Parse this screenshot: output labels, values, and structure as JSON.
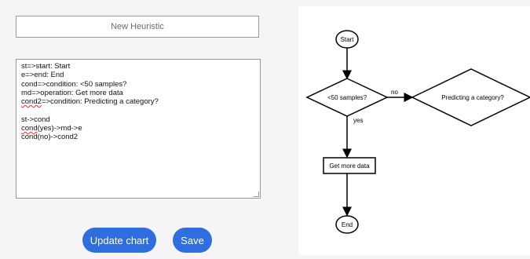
{
  "editor": {
    "name_placeholder": "New Heuristic",
    "code_lines": [
      {
        "text": "st=>start: Start",
        "err": ""
      },
      {
        "text": "e=>end: End",
        "err": ""
      },
      {
        "text": "cond=>condition: <50 samples?",
        "err": ""
      },
      {
        "text": "md=>operation: Get more data",
        "err": ""
      },
      {
        "pre": "",
        "err": "cond2",
        "text": "=>condition: Predicting a category?"
      },
      {
        "text": "",
        "err": ""
      },
      {
        "text": "st->cond",
        "err": ""
      },
      {
        "pre": "",
        "err": "cond",
        "text": "(yes)->md->e"
      },
      {
        "text": "cond(no)->cond2",
        "err": ""
      }
    ]
  },
  "buttons": {
    "update_label": "Update chart",
    "save_label": "Save"
  },
  "flowchart": {
    "start_label": "Start",
    "end_label": "End",
    "cond_label": "<50 samples?",
    "cond2_label": "Predicting a category?",
    "op_label": "Get more data",
    "yes_label": "yes",
    "no_label": "no"
  }
}
